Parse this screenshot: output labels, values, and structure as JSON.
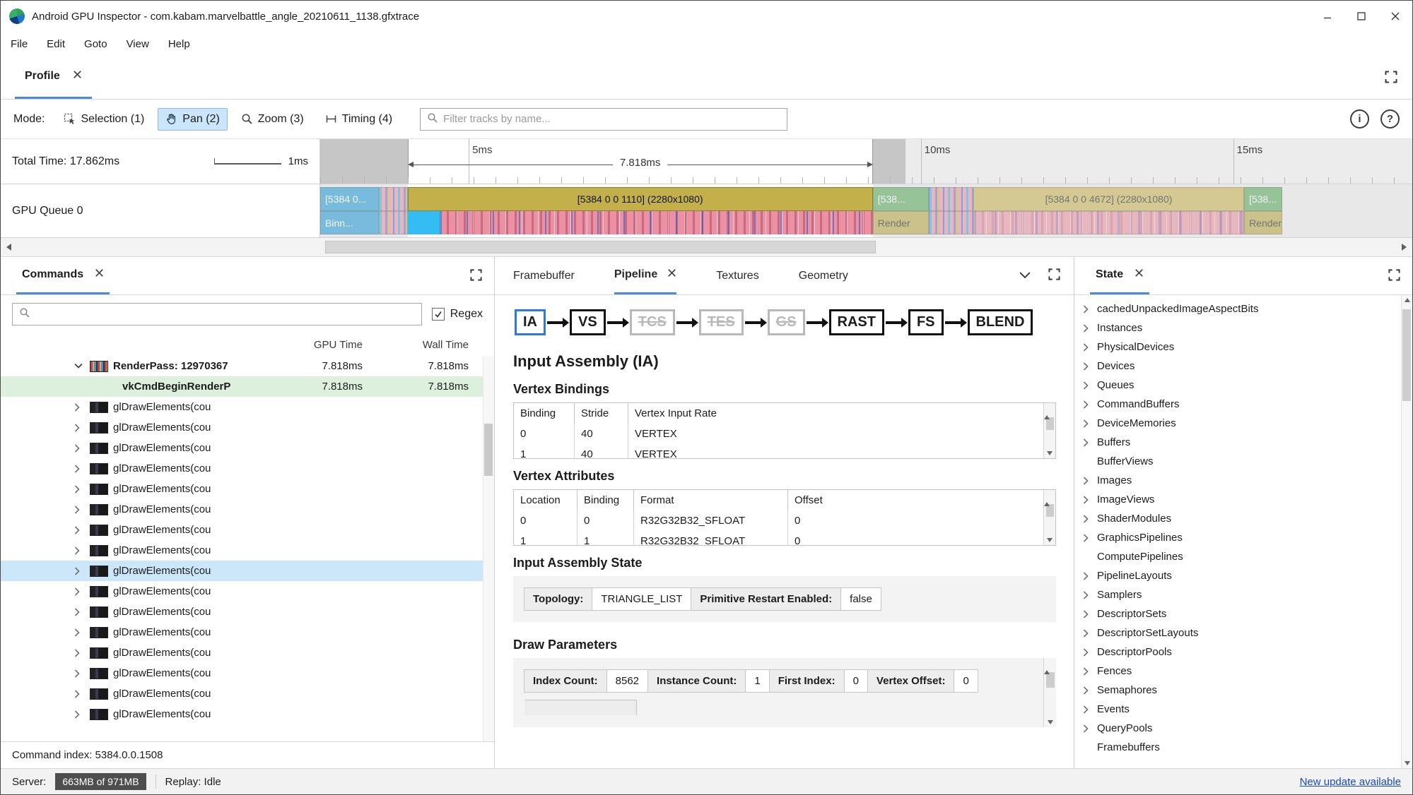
{
  "window": {
    "title": "Android GPU Inspector - com.kabam.marvelbattle_angle_20210611_1138.gfxtrace",
    "menu": [
      "File",
      "Edit",
      "Goto",
      "View",
      "Help"
    ]
  },
  "profile": {
    "tab_label": "Profile"
  },
  "toolbar": {
    "mode_label": "Mode:",
    "modes": [
      {
        "label": "Selection (1)",
        "active": false
      },
      {
        "label": "Pan (2)",
        "active": true
      },
      {
        "label": "Zoom (3)",
        "active": false
      },
      {
        "label": "Timing (4)",
        "active": false
      }
    ],
    "filter_placeholder": "Filter tracks by name..."
  },
  "timeline": {
    "total_time": "Total Time: 17.862ms",
    "scale": "1ms",
    "ticks": [
      "5ms",
      "10ms",
      "15ms"
    ],
    "selection_duration": "7.818ms",
    "queue_label": "GPU Queue 0",
    "slices": [
      {
        "label": "[5384 0...",
        "sublabel": "Binn...",
        "color": "#1d95d3"
      },
      {
        "label": "[5384 0 0 1110] (2280x1080)",
        "color": "#c3b04b"
      },
      {
        "label": "[538...",
        "sublabel": "Render",
        "color": "#55a556"
      },
      {
        "label": "[5384 0 0 4672] (2280x1080)",
        "color": "#b5a343"
      },
      {
        "label": "[538...",
        "sublabel": "Render",
        "color": "#55a556"
      }
    ]
  },
  "commands": {
    "tab_label": "Commands",
    "regex_label": "Regex",
    "columns": {
      "gpu": "GPU Time",
      "wall": "Wall Time"
    },
    "rows": [
      {
        "type": "renderpass",
        "label": "RenderPass: 12970367",
        "gpu": "7.818ms",
        "wall": "7.818ms"
      },
      {
        "type": "begin",
        "label": "vkCmdBeginRenderP",
        "gpu": "7.818ms",
        "wall": "7.818ms"
      },
      {
        "type": "draw",
        "label": "glDrawElements(cou"
      },
      {
        "type": "draw",
        "label": "glDrawElements(cou"
      },
      {
        "type": "draw",
        "label": "glDrawElements(cou"
      },
      {
        "type": "draw",
        "label": "glDrawElements(cou"
      },
      {
        "type": "draw",
        "label": "glDrawElements(cou"
      },
      {
        "type": "draw",
        "label": "glDrawElements(cou"
      },
      {
        "type": "draw",
        "label": "glDrawElements(cou"
      },
      {
        "type": "draw",
        "label": "glDrawElements(cou"
      },
      {
        "type": "draw",
        "label": "glDrawElements(cou",
        "selected": true
      },
      {
        "type": "draw",
        "label": "glDrawElements(cou"
      },
      {
        "type": "draw",
        "label": "glDrawElements(cou"
      },
      {
        "type": "draw",
        "label": "glDrawElements(cou"
      },
      {
        "type": "draw",
        "label": "glDrawElements(cou"
      },
      {
        "type": "draw",
        "label": "glDrawElements(cou"
      },
      {
        "type": "draw",
        "label": "glDrawElements(cou"
      },
      {
        "type": "draw",
        "label": "glDrawElements(cou"
      }
    ],
    "footer": "Command index: 5384.0.0.1508"
  },
  "inspector": {
    "tabs": [
      {
        "label": "Framebuffer",
        "active": false
      },
      {
        "label": "Pipeline",
        "active": true
      },
      {
        "label": "Textures",
        "active": false
      },
      {
        "label": "Geometry",
        "active": false
      }
    ],
    "stages": [
      {
        "label": "IA",
        "state": "selected"
      },
      {
        "label": "VS",
        "state": "normal"
      },
      {
        "label": "TCS",
        "state": "disabled"
      },
      {
        "label": "TES",
        "state": "disabled"
      },
      {
        "label": "GS",
        "state": "disabled"
      },
      {
        "label": "RAST",
        "state": "normal"
      },
      {
        "label": "FS",
        "state": "normal"
      },
      {
        "label": "BLEND",
        "state": "normal"
      }
    ],
    "title": "Input Assembly (IA)",
    "vertex_bindings": {
      "title": "Vertex Bindings",
      "columns": [
        "Binding",
        "Stride",
        "Vertex Input Rate"
      ],
      "rows": [
        [
          "0",
          "40",
          "VERTEX"
        ],
        [
          "1",
          "40",
          "VERTEX"
        ]
      ]
    },
    "vertex_attributes": {
      "title": "Vertex Attributes",
      "columns": [
        "Location",
        "Binding",
        "Format",
        "Offset"
      ],
      "rows": [
        [
          "0",
          "0",
          "R32G32B32_SFLOAT",
          "0"
        ],
        [
          "1",
          "1",
          "R32G32B32_SFLOAT",
          "0"
        ]
      ]
    },
    "input_assembly_state": {
      "title": "Input Assembly State",
      "fields": [
        {
          "label": "Topology:",
          "value": "TRIANGLE_LIST"
        },
        {
          "label": "Primitive Restart Enabled:",
          "value": "false"
        }
      ]
    },
    "draw_parameters": {
      "title": "Draw Parameters",
      "fields": [
        {
          "label": "Index Count:",
          "value": "8562"
        },
        {
          "label": "Instance Count:",
          "value": "1"
        },
        {
          "label": "First Index:",
          "value": "0"
        },
        {
          "label": "Vertex Offset:",
          "value": "0"
        }
      ]
    }
  },
  "state": {
    "tab_label": "State",
    "items": [
      {
        "label": "cachedUnpackedImageAspectBits",
        "chevron": true
      },
      {
        "label": "Instances",
        "chevron": true
      },
      {
        "label": "PhysicalDevices",
        "chevron": true
      },
      {
        "label": "Devices",
        "chevron": true
      },
      {
        "label": "Queues",
        "chevron": true
      },
      {
        "label": "CommandBuffers",
        "chevron": true
      },
      {
        "label": "DeviceMemories",
        "chevron": true
      },
      {
        "label": "Buffers",
        "chevron": true
      },
      {
        "label": "BufferViews",
        "chevron": false
      },
      {
        "label": "Images",
        "chevron": true
      },
      {
        "label": "ImageViews",
        "chevron": true
      },
      {
        "label": "ShaderModules",
        "chevron": true
      },
      {
        "label": "GraphicsPipelines",
        "chevron": true
      },
      {
        "label": "ComputePipelines",
        "chevron": false
      },
      {
        "label": "PipelineLayouts",
        "chevron": true
      },
      {
        "label": "Samplers",
        "chevron": true
      },
      {
        "label": "DescriptorSets",
        "chevron": true
      },
      {
        "label": "DescriptorSetLayouts",
        "chevron": true
      },
      {
        "label": "DescriptorPools",
        "chevron": true
      },
      {
        "label": "Fences",
        "chevron": true
      },
      {
        "label": "Semaphores",
        "chevron": true
      },
      {
        "label": "Events",
        "chevron": true
      },
      {
        "label": "QueryPools",
        "chevron": true
      },
      {
        "label": "Framebuffers",
        "chevron": false
      }
    ]
  },
  "statusbar": {
    "server_label": "Server:",
    "server_value": "663MB of 971MB",
    "replay_label": "Replay: Idle",
    "update_link": "New update available"
  }
}
